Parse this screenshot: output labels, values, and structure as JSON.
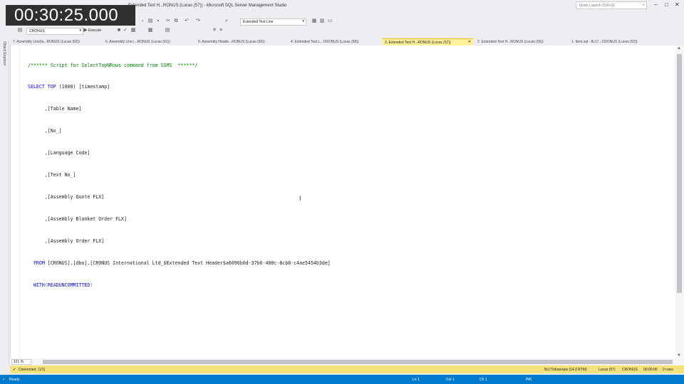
{
  "video": {
    "timestamp": "00:30:25.000"
  },
  "window": {
    "title": "Extended Text H...RONUS (Lucas (57)) - Microsoft SQL Server Management Studio",
    "quick_launch": "Quick Launch (Ctrl+Q)"
  },
  "toolbar": {
    "table_combo": "Extended Text Line",
    "database_combo": "CRONUS",
    "execute_label": "Execute"
  },
  "left_panel": {
    "label": "Object Explorer"
  },
  "tabs": [
    {
      "label": "7. Assembly Line(la...RONUS (Lucas (62))",
      "active": false
    },
    {
      "label": "6. Assembly Line i...RONUS (Lucas (61))",
      "active": false
    },
    {
      "label": "5. Assembly Heade...RONUS (Lucas (60))",
      "active": false
    },
    {
      "label": "4. Extended Text L...CRONUS (Lucas (58))",
      "active": false
    },
    {
      "label": "3. Extended Text H...RONUS (Lucas (57))",
      "active": true
    },
    {
      "label": "2. Extended Text H...RONUS (Lucas (56))",
      "active": false
    },
    {
      "label": "1. Item.sql - 8c17...CRONUS (Lucas (52))",
      "active": false
    }
  ],
  "code": {
    "l1": "/****** Script for SelectTopNRows command from SSMS  ******/",
    "l2_kw": "SELECT TOP",
    "l2_rest": " (1000) [timestamp]",
    "l3": "      ,[Table Name]",
    "l4": "      ,[No_]",
    "l5": "      ,[Language Code]",
    "l6": "      ,[Text No_]",
    "l7": "      ,[Assembly Quote FLX]",
    "l8": "      ,[Assembly Blanket Order FLX]",
    "l9": "      ,[Assembly Order FLX]",
    "l10_kw": "  FROM",
    "l10_rest": " [CRONUS].[dbo].[CRONUS International Ltd_$Extended Text Header$a6096b0d-37b6-400c-8cb8-c4ae5454b3de]",
    "l11_kw": "  WITH",
    "l11_open": "(",
    "l11_hint": "READUNCOMMITTED",
    "l11_close": ")"
  },
  "editor": {
    "zoom": "121 %"
  },
  "query_status": {
    "connected": "Connected. (1/1)",
    "server": "8c17\\sfusexpw (14.0 RTM)",
    "user": "Lucas (57)",
    "database": "CRONUS",
    "elapsed": "00:00:00",
    "rows": "0 rows"
  },
  "statusbar": {
    "ready": "Ready",
    "ln": "Ln 1",
    "col": "Col 1",
    "ch": "Ch 1",
    "ins": "INS"
  },
  "colors": {
    "accent": "#007acc",
    "query_status_bg": "#f5e27b",
    "active_tab_bg": "#fff09b",
    "keyword": "#0000ff",
    "comment": "#008000"
  }
}
